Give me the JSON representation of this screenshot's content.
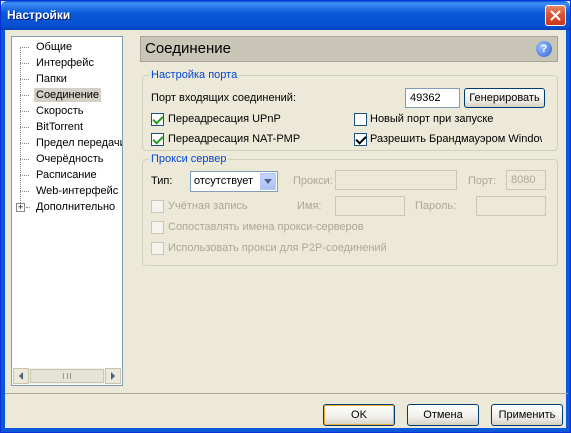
{
  "window": {
    "title": "Настройки"
  },
  "tree": {
    "items": [
      {
        "label": "Общие"
      },
      {
        "label": "Интерфейс"
      },
      {
        "label": "Папки"
      },
      {
        "label": "Соединение"
      },
      {
        "label": "Скорость"
      },
      {
        "label": "BitTorrent"
      },
      {
        "label": "Предел передачи"
      },
      {
        "label": "Очерёдность"
      },
      {
        "label": "Расписание"
      },
      {
        "label": "Web-интерфейс"
      },
      {
        "label": "Дополнительно"
      }
    ],
    "selected": "Соединение"
  },
  "panel": {
    "title": "Соединение"
  },
  "port_group": {
    "legend": "Настройка порта",
    "port_label": "Порт входящих соединений:",
    "port_value": "49362",
    "generate_label": "Генерировать",
    "upnp_label": "Переадресация UPnP",
    "upnp_checked": true,
    "natpmp_label": "Переадресация NAT-PMP",
    "natpmp_checked": true,
    "new_port_label": "Новый порт при запуске",
    "new_port_checked": false,
    "firewall_label": "Разрешить Брандмауэром Windows",
    "firewall_checked": true
  },
  "proxy_group": {
    "legend": "Прокси сервер",
    "type_label": "Тип:",
    "type_value": "отсутствует",
    "proxy_label": "Прокси:",
    "proxy_value": "",
    "port_label": "Порт:",
    "port_value": "8080",
    "auth_label": "Учётная запись",
    "name_label": "Имя:",
    "name_value": "",
    "password_label": "Пароль:",
    "password_value": "",
    "map_names_label": "Сопоставлять имена прокси-серверов",
    "p2p_label": "Использовать прокси для P2P-соединений"
  },
  "footer": {
    "ok_label": "OK",
    "cancel_label": "Отмена",
    "apply_label": "Применить"
  }
}
